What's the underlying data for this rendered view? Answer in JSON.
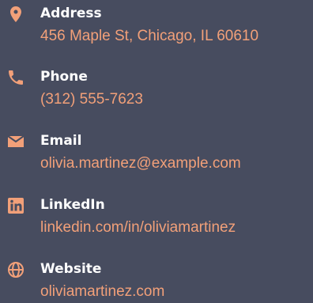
{
  "accent_color": "#f2a079",
  "background_color": "#474c5f",
  "contact": {
    "address": {
      "label": "Address",
      "value": "456 Maple St, Chicago, IL 60610",
      "icon": "location-pin-icon"
    },
    "phone": {
      "label": "Phone",
      "value": "(312) 555-7623",
      "icon": "phone-icon"
    },
    "email": {
      "label": "Email",
      "value": "olivia.martinez@example.com",
      "icon": "envelope-icon"
    },
    "linkedin": {
      "label": "LinkedIn",
      "value": "linkedin.com/in/oliviamartinez",
      "icon": "linkedin-icon"
    },
    "website": {
      "label": "Website",
      "value": "oliviamartinez.com",
      "icon": "globe-icon"
    }
  }
}
